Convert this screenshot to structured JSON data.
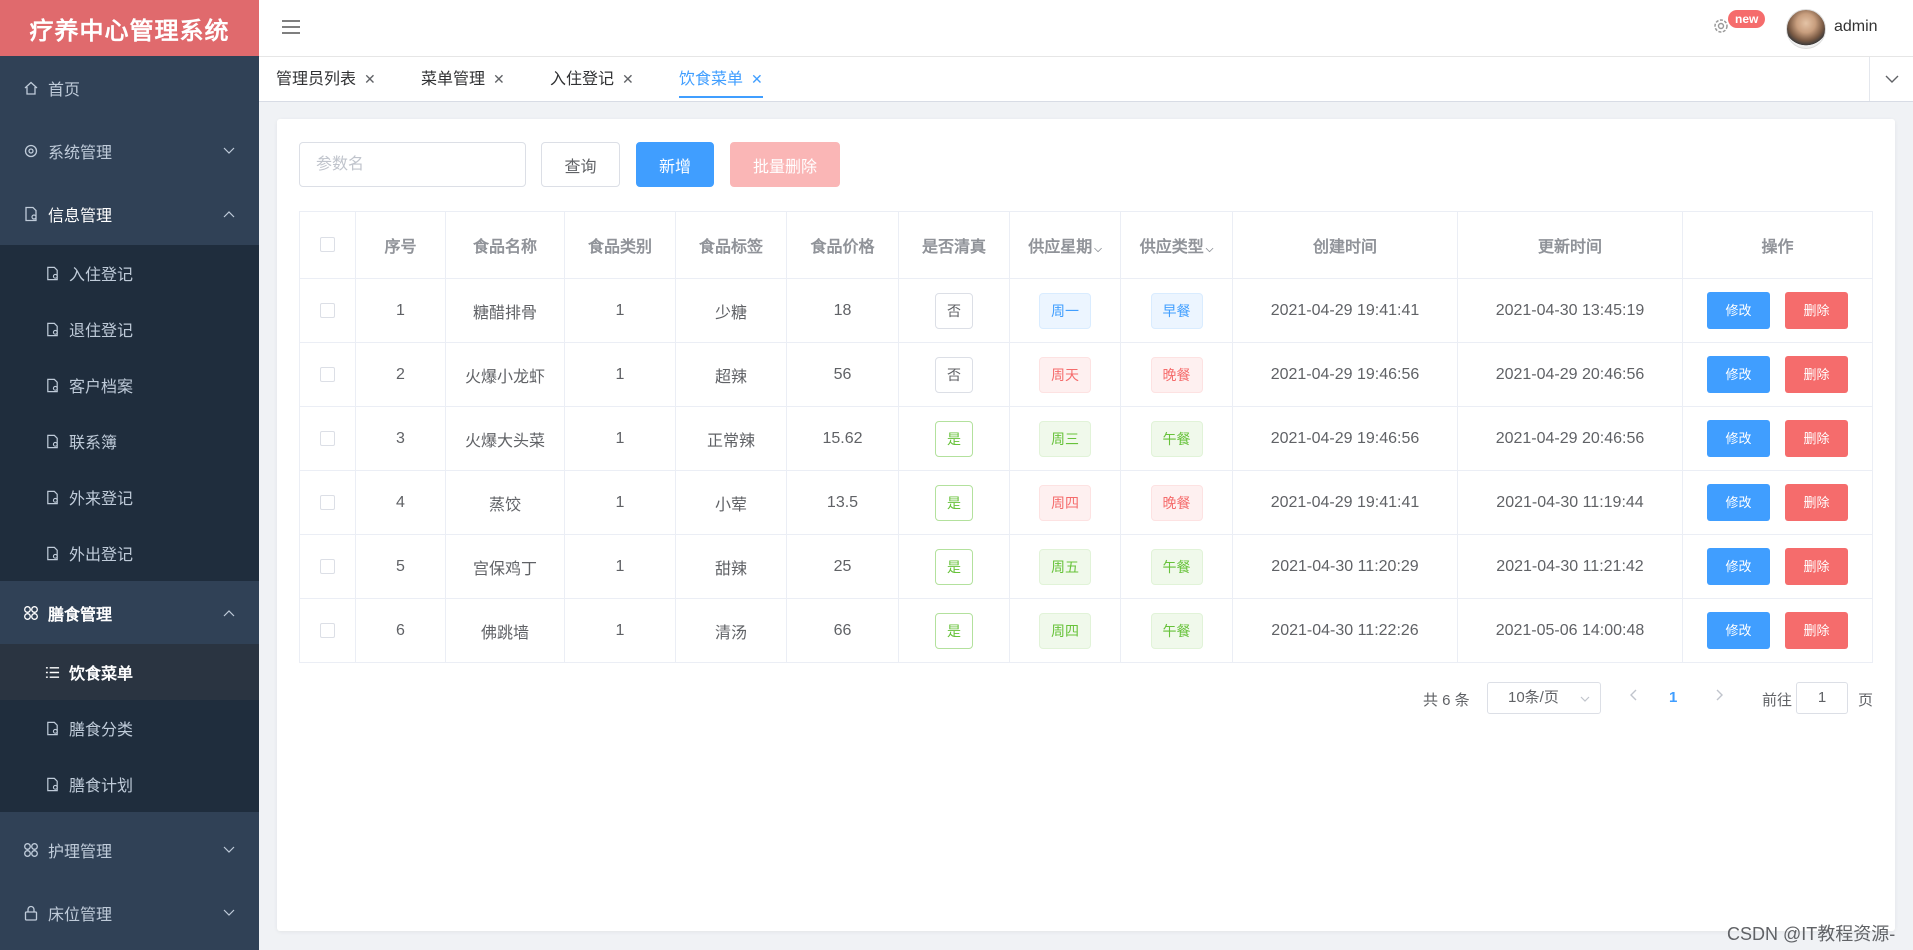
{
  "app": {
    "title": "疗养中心管理系统"
  },
  "sidebar": {
    "home": "首页",
    "groups": [
      {
        "label": "系统管理"
      },
      {
        "label": "信息管理",
        "items": [
          "入住登记",
          "退住登记",
          "客户档案",
          "联系簿",
          "外来登记",
          "外出登记"
        ]
      },
      {
        "label": "膳食管理",
        "items": [
          "饮食菜单",
          "膳食分类",
          "膳食计划"
        ]
      },
      {
        "label": "护理管理"
      },
      {
        "label": "床位管理"
      }
    ]
  },
  "header": {
    "badge": "new",
    "user": "admin"
  },
  "tabs": [
    {
      "label": "管理员列表"
    },
    {
      "label": "菜单管理"
    },
    {
      "label": "入住登记"
    },
    {
      "label": "饮食菜单",
      "active": true
    }
  ],
  "toolbar": {
    "search_placeholder": "参数名",
    "query": "查询",
    "add": "新增",
    "batch_delete": "批量删除"
  },
  "table": {
    "headers": [
      "序号",
      "食品名称",
      "食品类别",
      "食品标签",
      "食品价格",
      "是否清真",
      "供应星期",
      "供应类型",
      "创建时间",
      "更新时间",
      "操作"
    ],
    "rows": [
      [
        "1",
        "糖醋排骨",
        "1",
        "少糖",
        "18",
        "否",
        "周一",
        "早餐",
        "2021-04-29 19:41:41",
        "2021-04-30 13:45:19"
      ],
      [
        "2",
        "火爆小龙虾",
        "1",
        "超辣",
        "56",
        "否",
        "周天",
        "晚餐",
        "2021-04-29 19:46:56",
        "2021-04-29 20:46:56"
      ],
      [
        "3",
        "火爆大头菜",
        "1",
        "正常辣",
        "15.62",
        "是",
        "周三",
        "午餐",
        "2021-04-29 19:46:56",
        "2021-04-29 20:46:56"
      ],
      [
        "4",
        "蒸饺",
        "1",
        "小荤",
        "13.5",
        "是",
        "周四",
        "晚餐",
        "2021-04-29 19:41:41",
        "2021-04-30 11:19:44"
      ],
      [
        "5",
        "宫保鸡丁",
        "1",
        "甜辣",
        "25",
        "是",
        "周五",
        "午餐",
        "2021-04-30 11:20:29",
        "2021-04-30 11:21:42"
      ],
      [
        "6",
        "佛跳墙",
        "1",
        "清汤",
        "66",
        "是",
        "周四",
        "午餐",
        "2021-04-30 11:22:26",
        "2021-05-06 14:00:48"
      ]
    ],
    "edit_label": "修改",
    "delete_label": "删除"
  },
  "pagination": {
    "total": "共 6 条",
    "page_size": "10条/页",
    "current_page": "1",
    "goto_prefix": "前往",
    "goto_value": "1",
    "goto_suffix": "页"
  },
  "watermark": "CSDN @IT教程资源-"
}
